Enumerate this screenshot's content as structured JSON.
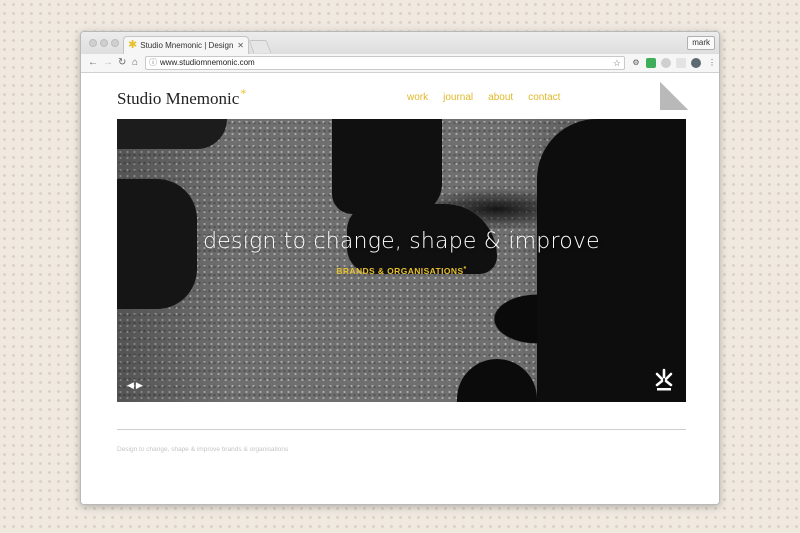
{
  "browser": {
    "tab_title": "Studio Mnemonic | Design to c",
    "tab_close": "✕",
    "profile_name": "mark",
    "url": "www.studiomnemonic.com",
    "icons": {
      "back": "←",
      "forward": "→",
      "reload": "↻",
      "home": "⌂",
      "info": "ⓘ",
      "star": "☆",
      "settings": "⚙",
      "menu": "⋮"
    }
  },
  "site": {
    "logo_text": "Studio Mnemonic",
    "logo_mark": "*",
    "nav": [
      "work",
      "journal",
      "about",
      "contact"
    ],
    "hero": {
      "heading": "design to change, shape & improve",
      "subheading": "BRANDS & ORGANISATIONS",
      "sub_mark": "*",
      "prev_arrow": "◀",
      "next_arrow": "▶"
    },
    "footer_text": "Design to change, shape & improve brands & organisations"
  },
  "colors": {
    "accent": "#e8c02e",
    "nav_link": "#e0b82a",
    "footer_text": "#c4c4c4",
    "page_background": "#efe9e0"
  }
}
